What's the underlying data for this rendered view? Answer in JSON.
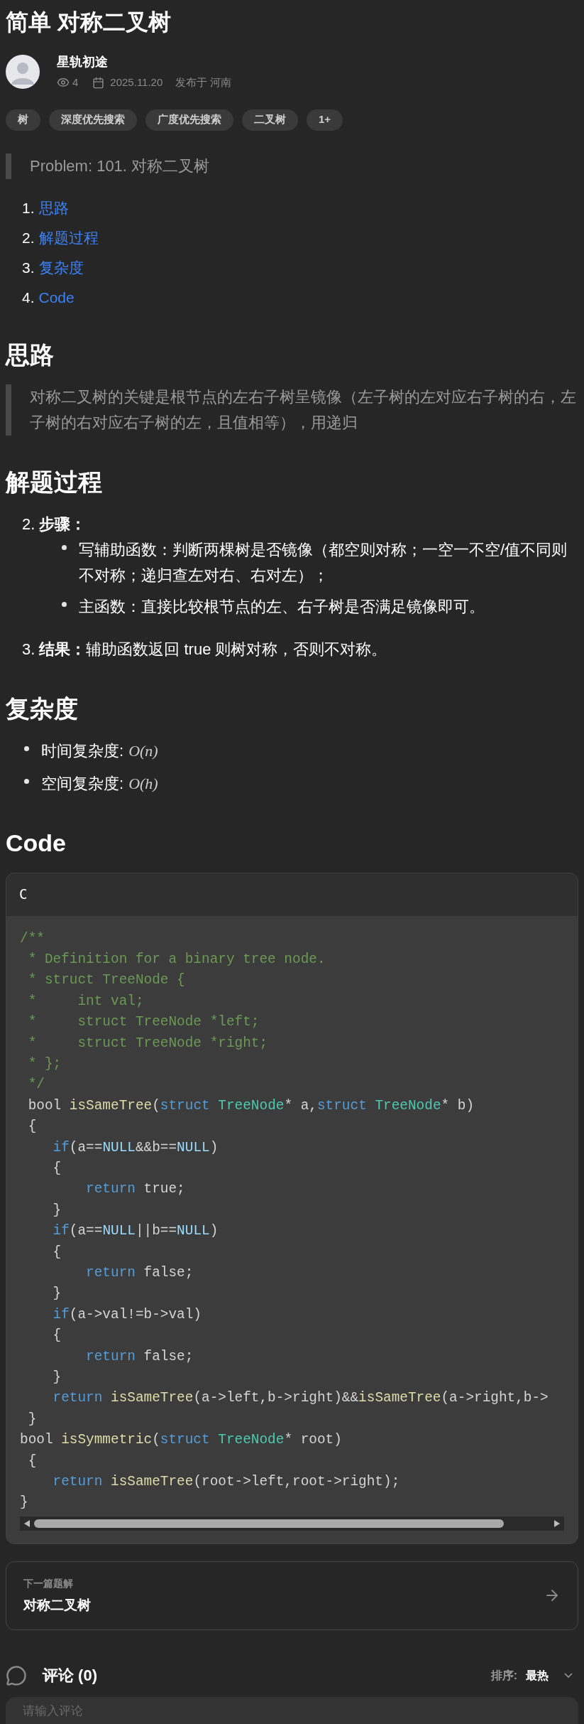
{
  "title": "简单 对称二叉树",
  "author": {
    "name": "星轨初途",
    "views": "4",
    "date": "2025.11.20",
    "location": "发布于 河南"
  },
  "tags": [
    "树",
    "深度优先搜索",
    "广度优先搜索",
    "二叉树",
    "1+"
  ],
  "problem": "Problem: 101. 对称二叉树",
  "toc": [
    {
      "number": "1.",
      "label": "思路"
    },
    {
      "number": "2.",
      "label": "解题过程"
    },
    {
      "number": "3.",
      "label": "复杂度"
    },
    {
      "number": "4.",
      "label": "Code"
    }
  ],
  "section_idea": {
    "heading": "思路",
    "quote": "对称二叉树的关键是根节点的左右子树呈镜像（左子树的左对应右子树的右，左子树的右对应右子树的左，且值相等），用递归"
  },
  "section_process": {
    "heading": "解题过程",
    "steps": [
      {
        "number": "2.",
        "label": "步骤：",
        "bullets": [
          "写辅助函数：判断两棵树是否镜像（都空则对称；一空一不空/值不同则不对称；递归查左对右、右对左）；",
          "主函数：直接比较根节点的左、右子树是否满足镜像即可。"
        ]
      },
      {
        "number": "3.",
        "label": "结果：",
        "text": "辅助函数返回 true 则树对称，否则不对称。"
      }
    ]
  },
  "section_complexity": {
    "heading": "复杂度",
    "items": [
      {
        "label": "时间复杂度:",
        "formula": "O(n)"
      },
      {
        "label": "空间复杂度:",
        "formula": "O(h)"
      }
    ]
  },
  "section_code": {
    "heading": "Code",
    "language": "C",
    "lines": [
      [
        {
          "kind": "comment",
          "text": "/**"
        }
      ],
      [
        {
          "kind": "comment",
          "text": " * Definition for a binary tree node."
        }
      ],
      [
        {
          "kind": "comment",
          "text": " * struct TreeNode {"
        }
      ],
      [
        {
          "kind": "comment",
          "text": " *     int val;"
        }
      ],
      [
        {
          "kind": "comment",
          "text": " *     struct TreeNode *left;"
        }
      ],
      [
        {
          "kind": "comment",
          "text": " *     struct TreeNode *right;"
        }
      ],
      [
        {
          "kind": "comment",
          "text": " * };"
        }
      ],
      [
        {
          "kind": "comment",
          "text": " */"
        }
      ],
      [
        {
          "kind": "plain",
          "text": " bool "
        },
        {
          "kind": "func",
          "text": "isSameTree"
        },
        {
          "kind": "plain",
          "text": "("
        },
        {
          "kind": "keyword",
          "text": "struct "
        },
        {
          "kind": "type",
          "text": "TreeNode"
        },
        {
          "kind": "plain",
          "text": "* a,"
        },
        {
          "kind": "keyword",
          "text": "struct "
        },
        {
          "kind": "type",
          "text": "TreeNode"
        },
        {
          "kind": "plain",
          "text": "* b)"
        }
      ],
      [
        {
          "kind": "plain",
          "text": " {"
        }
      ],
      [
        {
          "kind": "keyword",
          "text": "    if"
        },
        {
          "kind": "plain",
          "text": "(a=="
        },
        {
          "kind": "const",
          "text": "NULL"
        },
        {
          "kind": "plain",
          "text": "&&b=="
        },
        {
          "kind": "const",
          "text": "NULL"
        },
        {
          "kind": "plain",
          "text": ")"
        }
      ],
      [
        {
          "kind": "plain",
          "text": "    {"
        }
      ],
      [
        {
          "kind": "keyword",
          "text": "        return"
        },
        {
          "kind": "plain",
          "text": " true;"
        }
      ],
      [
        {
          "kind": "plain",
          "text": "    }"
        }
      ],
      [
        {
          "kind": "keyword",
          "text": "    if"
        },
        {
          "kind": "plain",
          "text": "(a=="
        },
        {
          "kind": "const",
          "text": "NULL"
        },
        {
          "kind": "plain",
          "text": "||b=="
        },
        {
          "kind": "const",
          "text": "NULL"
        },
        {
          "kind": "plain",
          "text": ")"
        }
      ],
      [
        {
          "kind": "plain",
          "text": "    {"
        }
      ],
      [
        {
          "kind": "keyword",
          "text": "        return"
        },
        {
          "kind": "plain",
          "text": " false;"
        }
      ],
      [
        {
          "kind": "plain",
          "text": "    }"
        }
      ],
      [
        {
          "kind": "keyword",
          "text": "    if"
        },
        {
          "kind": "plain",
          "text": "(a->val!=b->val)"
        }
      ],
      [
        {
          "kind": "plain",
          "text": "    {"
        }
      ],
      [
        {
          "kind": "keyword",
          "text": "        return"
        },
        {
          "kind": "plain",
          "text": " false;"
        }
      ],
      [
        {
          "kind": "plain",
          "text": "    }"
        }
      ],
      [
        {
          "kind": "keyword",
          "text": "    return "
        },
        {
          "kind": "func",
          "text": "isSameTree"
        },
        {
          "kind": "plain",
          "text": "(a->left,b->right)&&"
        },
        {
          "kind": "func",
          "text": "isSameTree"
        },
        {
          "kind": "plain",
          "text": "(a->right,b->"
        }
      ],
      [
        {
          "kind": "plain",
          "text": " }"
        }
      ],
      [
        {
          "kind": "plain",
          "text": "bool "
        },
        {
          "kind": "func",
          "text": "isSymmetric"
        },
        {
          "kind": "plain",
          "text": "("
        },
        {
          "kind": "keyword",
          "text": "struct "
        },
        {
          "kind": "type",
          "text": "TreeNode"
        },
        {
          "kind": "plain",
          "text": "* root)"
        }
      ],
      [
        {
          "kind": "plain",
          "text": " {"
        }
      ],
      [
        {
          "kind": "keyword",
          "text": "    return "
        },
        {
          "kind": "func",
          "text": "isSameTree"
        },
        {
          "kind": "plain",
          "text": "(root->left,root->right);"
        }
      ],
      [
        {
          "kind": "plain",
          "text": "}"
        }
      ]
    ]
  },
  "next": {
    "caption": "下一篇题解",
    "title": "对称二叉树"
  },
  "comments": {
    "title": "评论 (0)",
    "sort_label": "排序:",
    "sort_value": "最热",
    "placeholder": "请输入评论"
  }
}
